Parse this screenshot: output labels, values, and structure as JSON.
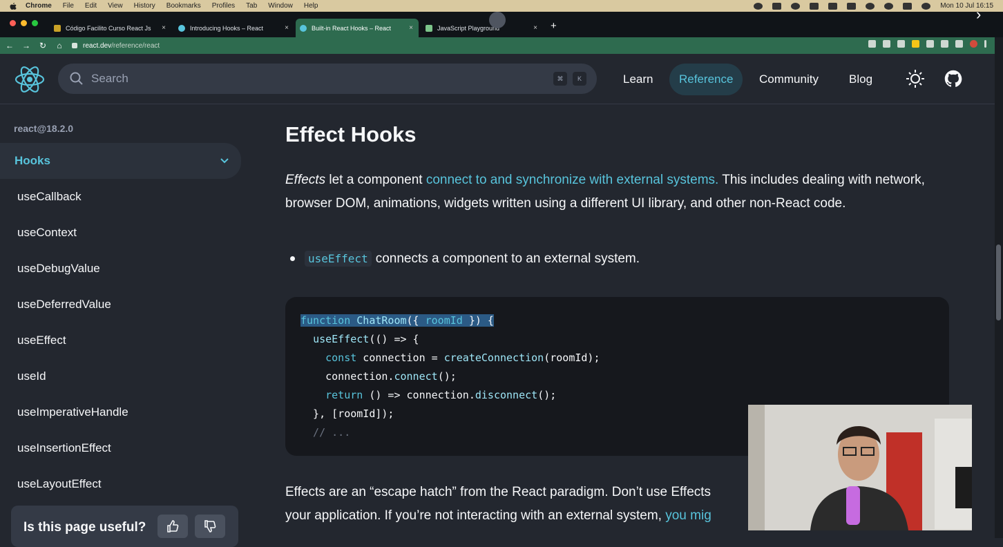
{
  "os_menubar": {
    "app": "Chrome",
    "items": [
      "File",
      "Edit",
      "View",
      "History",
      "Bookmarks",
      "Profiles",
      "Tab",
      "Window",
      "Help"
    ],
    "clock": "Mon 10 Jul  16:15"
  },
  "browser": {
    "tabs": [
      {
        "title": "Código Facilito Curso React Js",
        "active": false
      },
      {
        "title": "Introducing Hooks – React",
        "active": false
      },
      {
        "title": "Built-in React Hooks – React",
        "active": true
      },
      {
        "title": "JavaScript Playground",
        "active": false
      }
    ],
    "url_host": "react.dev",
    "url_path": "/reference/react",
    "close_glyph": "×",
    "new_tab": "+"
  },
  "header": {
    "search_placeholder": "Search",
    "shortcut_keys": [
      "⌘",
      "K"
    ],
    "nav": [
      "Learn",
      "Reference",
      "Community",
      "Blog"
    ],
    "active_nav": "Reference"
  },
  "sidebar": {
    "version": "react@18.2.0",
    "section": "Hooks",
    "items": [
      "useCallback",
      "useContext",
      "useDebugValue",
      "useDeferredValue",
      "useEffect",
      "useId",
      "useImperativeHandle",
      "useInsertionEffect",
      "useLayoutEffect"
    ],
    "feedback_question": "Is this page useful?"
  },
  "main": {
    "title": "Effect Hooks",
    "intro_em": "Effects",
    "intro_mid": " let a component ",
    "intro_link": "connect to and synchronize with external systems.",
    "intro_rest": " This includes dealing with network, browser DOM, animations, widgets written using a different UI library, and other non-React code.",
    "bullet_code": "useEffect",
    "bullet_text": "connects a component to an external system.",
    "code_lines": [
      "function ChatRoom({ roomId }) {",
      "  useEffect(() => {",
      "    const connection = createConnection(roomId);",
      "    connection.connect();",
      "    return () => connection.disconnect();",
      "  }, [roomId]);",
      "  // ..."
    ],
    "para2_line1": "Effects are an “escape hatch” from the React paradigm. Don’t use Effects",
    "para2_line2_text": "your application. If you’re not interacting with an external system, ",
    "para2_line2_link": "you mig"
  },
  "colors": {
    "bg": "#23272f",
    "accent": "#58c4dc",
    "chrome_green": "#2e6b4f"
  }
}
